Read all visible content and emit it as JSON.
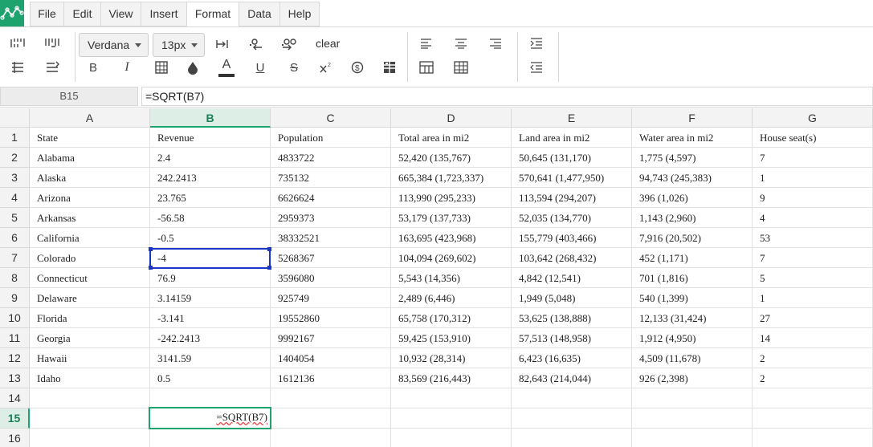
{
  "menu": {
    "items": [
      "File",
      "Edit",
      "View",
      "Insert",
      "Format",
      "Data",
      "Help"
    ],
    "active": "Format"
  },
  "toolbar": {
    "font_family": "Verdana",
    "font_size": "13px",
    "clear_label": "clear"
  },
  "formula_bar": {
    "cell_ref": "B15",
    "formula": "=SQRT(B7)"
  },
  "grid": {
    "columns": [
      "A",
      "B",
      "C",
      "D",
      "E",
      "F",
      "G"
    ],
    "selected_column": "B",
    "row_numbers": [
      "1",
      "2",
      "3",
      "4",
      "5",
      "6",
      "7",
      "8",
      "9",
      "10",
      "11",
      "12",
      "13",
      "14",
      "15",
      "16"
    ],
    "selected_row": "15",
    "rows": [
      [
        "State",
        "Revenue",
        "Population",
        "Total area in mi2",
        "Land area in mi2",
        "Water area in mi2",
        "House seat(s)"
      ],
      [
        "Alabama",
        "2.4",
        "4833722",
        "52,420 (135,767)",
        "50,645 (131,170)",
        "1,775 (4,597)",
        "7"
      ],
      [
        "Alaska",
        "242.2413",
        "735132",
        "665,384 (1,723,337)",
        "570,641 (1,477,950)",
        "94,743 (245,383)",
        "1"
      ],
      [
        "Arizona",
        "23.765",
        "6626624",
        "113,990 (295,233)",
        "113,594 (294,207)",
        "396 (1,026)",
        "9"
      ],
      [
        "Arkansas",
        "-56.58",
        "2959373",
        "53,179 (137,733)",
        "52,035 (134,770)",
        "1,143 (2,960)",
        "4"
      ],
      [
        "California",
        "-0.5",
        "38332521",
        "163,695 (423,968)",
        "155,779 (403,466)",
        "7,916 (20,502)",
        "53"
      ],
      [
        "Colorado",
        "-4",
        "5268367",
        "104,094 (269,602)",
        "103,642 (268,432)",
        "452 (1,171)",
        "7"
      ],
      [
        "Connecticut",
        "76.9",
        "3596080",
        "5,543 (14,356)",
        "4,842 (12,541)",
        "701 (1,816)",
        "5"
      ],
      [
        "Delaware",
        "3.14159",
        "925749",
        "2,489 (6,446)",
        "1,949 (5,048)",
        "540 (1,399)",
        "1"
      ],
      [
        "Florida",
        "-3.141",
        "19552860",
        "65,758 (170,312)",
        "53,625 (138,888)",
        "12,133 (31,424)",
        "27"
      ],
      [
        "Georgia",
        "-242.2413",
        "9992167",
        "59,425 (153,910)",
        "57,513 (148,958)",
        "1,912 (4,950)",
        "14"
      ],
      [
        "Hawaii",
        "3141.59",
        "1404054",
        "10,932 (28,314)",
        "6,423 (16,635)",
        "4,509 (11,678)",
        "2"
      ],
      [
        "Idaho",
        "0.5",
        "1612136",
        "83,569 (216,443)",
        "82,643 (214,044)",
        "926 (2,398)",
        "2"
      ],
      [
        "",
        "",
        "",
        "",
        "",
        "",
        ""
      ],
      [
        "",
        "",
        "",
        "",
        "",
        "",
        ""
      ],
      [
        "",
        "",
        "",
        "",
        "",
        "",
        ""
      ]
    ],
    "editing_cell_value": "=SQRT(B7)"
  },
  "colors": {
    "accent": "#1ea36f",
    "selection": "#1a36c8"
  }
}
